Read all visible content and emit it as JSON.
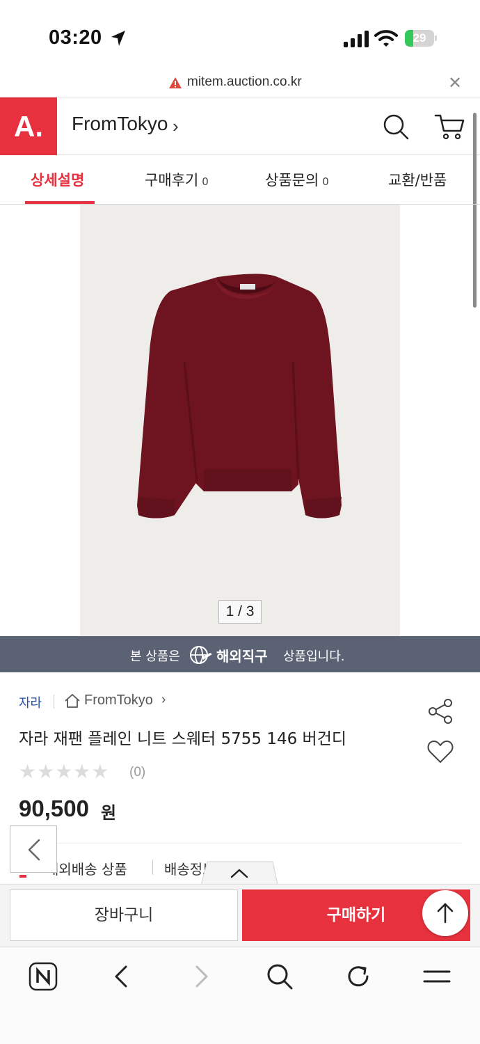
{
  "status_bar": {
    "time": "03:20",
    "battery_label": "29",
    "battery_level_percent": 29,
    "icons": [
      "location-arrow-icon",
      "cellular-signal-icon",
      "wifi-icon",
      "battery-icon"
    ]
  },
  "url_bar": {
    "domain": "mitem.auction.co.kr",
    "icons": [
      "warning-icon",
      "close-icon"
    ]
  },
  "header": {
    "logo_text": "A.",
    "store_name": "FromTokyo",
    "store_chevron": "›",
    "icons": [
      "search-icon",
      "cart-icon"
    ],
    "brand_color": "#e8313f"
  },
  "tabs": [
    {
      "label": "상세설명",
      "count": "",
      "active": true
    },
    {
      "label": "구매후기",
      "count": "0",
      "active": false
    },
    {
      "label": "상품문의",
      "count": "0",
      "active": false
    },
    {
      "label": "교환/반품",
      "count": "",
      "active": false
    }
  ],
  "gallery": {
    "counter": "1 / 3",
    "current": 1,
    "total": 3,
    "sweater_color": "#6e1420"
  },
  "overseas_banner": {
    "prefix": "본 상품은",
    "highlight": "해외직구",
    "suffix": "상품입니다.",
    "background": "#5b6273"
  },
  "product": {
    "brand": "자라",
    "seller": "FromTokyo",
    "seller_chevron": "›",
    "title": "자라 재팬 플레인 니트 스웨터 5755 146 버건디",
    "stars": "★★★★★",
    "rating": 0,
    "rating_count": "(0)",
    "price": "90,500",
    "price_unit": "원",
    "icons": [
      "share-icon",
      "heart-icon",
      "home-icon"
    ]
  },
  "shipping": {
    "tag": "해외배송 상품",
    "policy": "배송정보"
  },
  "actions": {
    "cart_label": "장바구니",
    "buy_label": "구매하기",
    "icons": [
      "chevron-left-icon",
      "chevron-up-icon",
      "arrow-up-icon"
    ]
  },
  "safari": {
    "icons": [
      "naver-icon",
      "back-icon",
      "forward-icon",
      "search-icon",
      "reload-icon",
      "menu-icon"
    ]
  }
}
